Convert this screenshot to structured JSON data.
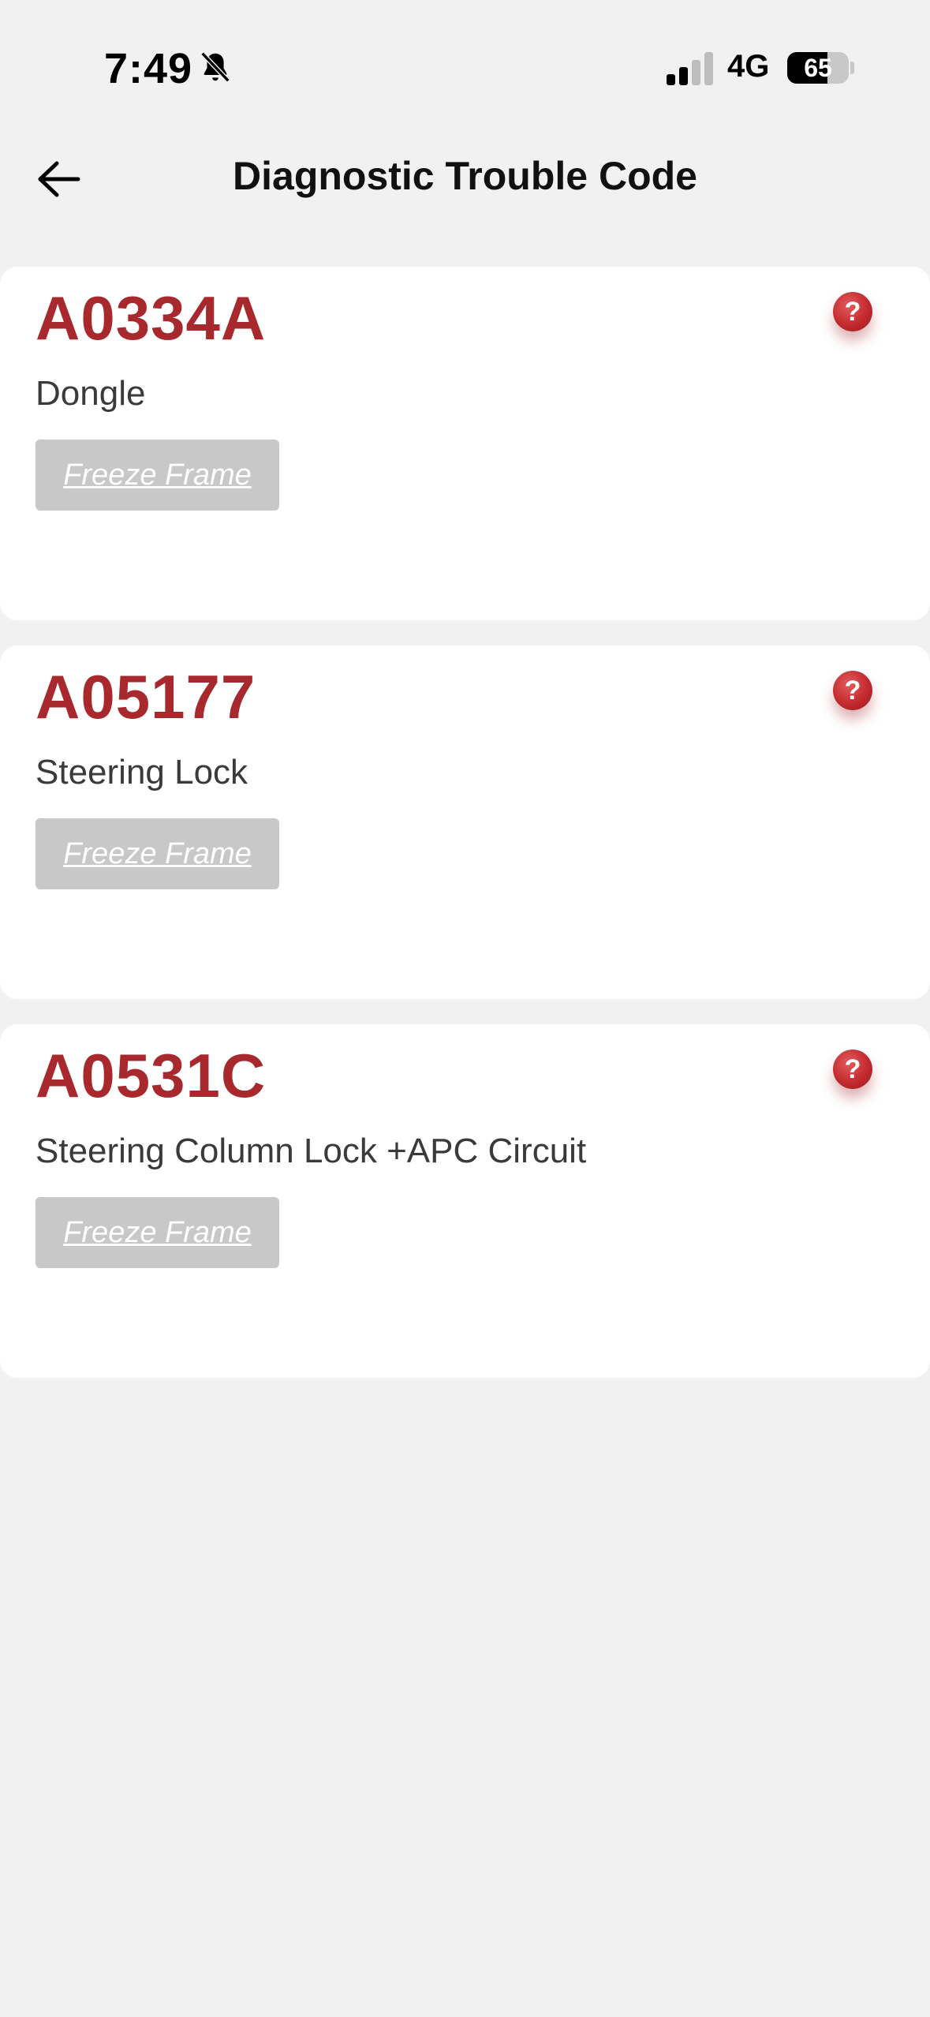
{
  "status_bar": {
    "time": "7:49",
    "network": "4G",
    "battery_level": "65",
    "battery_fraction": 0.65,
    "icons": [
      "bell-slash-icon",
      "signal-icon",
      "battery-icon"
    ]
  },
  "header": {
    "title": "Diagnostic Trouble Code",
    "back_icon": "arrow-left-icon"
  },
  "dtc_list": [
    {
      "code": "A0334A",
      "description": "Dongle",
      "button_label": "Freeze Frame",
      "help_label": "?"
    },
    {
      "code": "A05177",
      "description": "Steering Lock",
      "button_label": "Freeze Frame",
      "help_label": "?"
    },
    {
      "code": "A0531C",
      "description": "Steering Column Lock +APC Circuit",
      "button_label": "Freeze Frame",
      "help_label": "?"
    }
  ],
  "colors": {
    "background": "#f1f1f1",
    "card": "#ffffff",
    "code_red": "#a8292d",
    "help_red": "#c32a2f",
    "button_grey": "#c8c8c8"
  }
}
